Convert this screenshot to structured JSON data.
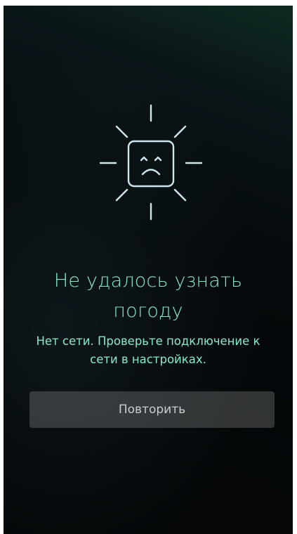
{
  "error": {
    "icon": "sad-sun-icon",
    "title_line1": "Не удалось узнать",
    "title_line2": "погоду",
    "message_line1": "Нет сети. Проверьте подключение к",
    "message_line2": "сети в настройках."
  },
  "actions": {
    "retry_label": "Повторить"
  },
  "colors": {
    "accent": "#86e8cc",
    "icon": "#cfe6ee",
    "button_text": "#c9cdcf"
  }
}
